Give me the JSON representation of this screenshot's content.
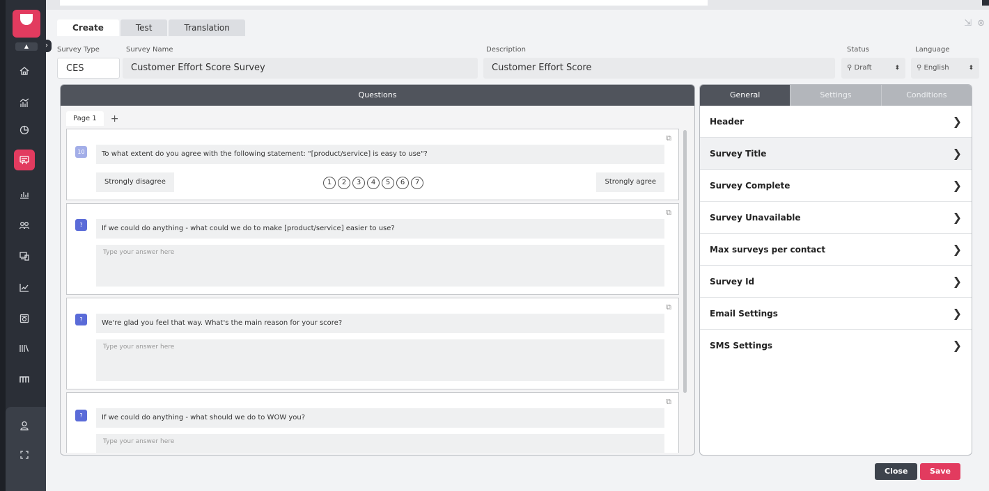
{
  "tabs": [
    "Create",
    "Test",
    "Translation"
  ],
  "fields": {
    "survey_type_label": "Survey Type",
    "survey_type": "CES",
    "survey_name_label": "Survey Name",
    "survey_name": "Customer Effort Score Survey",
    "description_label": "Description",
    "description": "Customer Effort Score",
    "status_label": "Status",
    "status": "Draft",
    "language_label": "Language",
    "language": "English"
  },
  "questions_panel": {
    "title": "Questions",
    "page_tab": "Page 1",
    "add_page": "+",
    "questions": [
      {
        "badge": "10",
        "text": "To what extent do you agree with the following statement: \"[product/service] is easy to use\"?",
        "scale_min_label": "Strongly disagree",
        "scale_max_label": "Strongly agree",
        "scale": [
          "1",
          "2",
          "3",
          "4",
          "5",
          "6",
          "7"
        ]
      },
      {
        "badge": "?",
        "text": "If we could do anything - what could we do to make [product/service] easier to use?",
        "placeholder": "Type your answer here"
      },
      {
        "badge": "?",
        "text": "We're glad you feel that way. What's the main reason for your score?",
        "placeholder": "Type your answer here"
      },
      {
        "badge": "?",
        "text": "If we could do anything - what should we do to WOW you?",
        "placeholder": "Type your answer here"
      }
    ]
  },
  "right_panel": {
    "tabs": [
      "General",
      "Settings",
      "Conditions"
    ],
    "items": [
      "Header",
      "Survey Title",
      "Survey Complete",
      "Survey Unavailable",
      "Max surveys per contact",
      "Survey Id",
      "Email Settings",
      "SMS Settings"
    ]
  },
  "buttons": {
    "close": "Close",
    "save": "Save"
  },
  "colors": {
    "accent": "#e23b5f",
    "sidebar": "#2b2f37",
    "panel_header": "#50545c"
  }
}
